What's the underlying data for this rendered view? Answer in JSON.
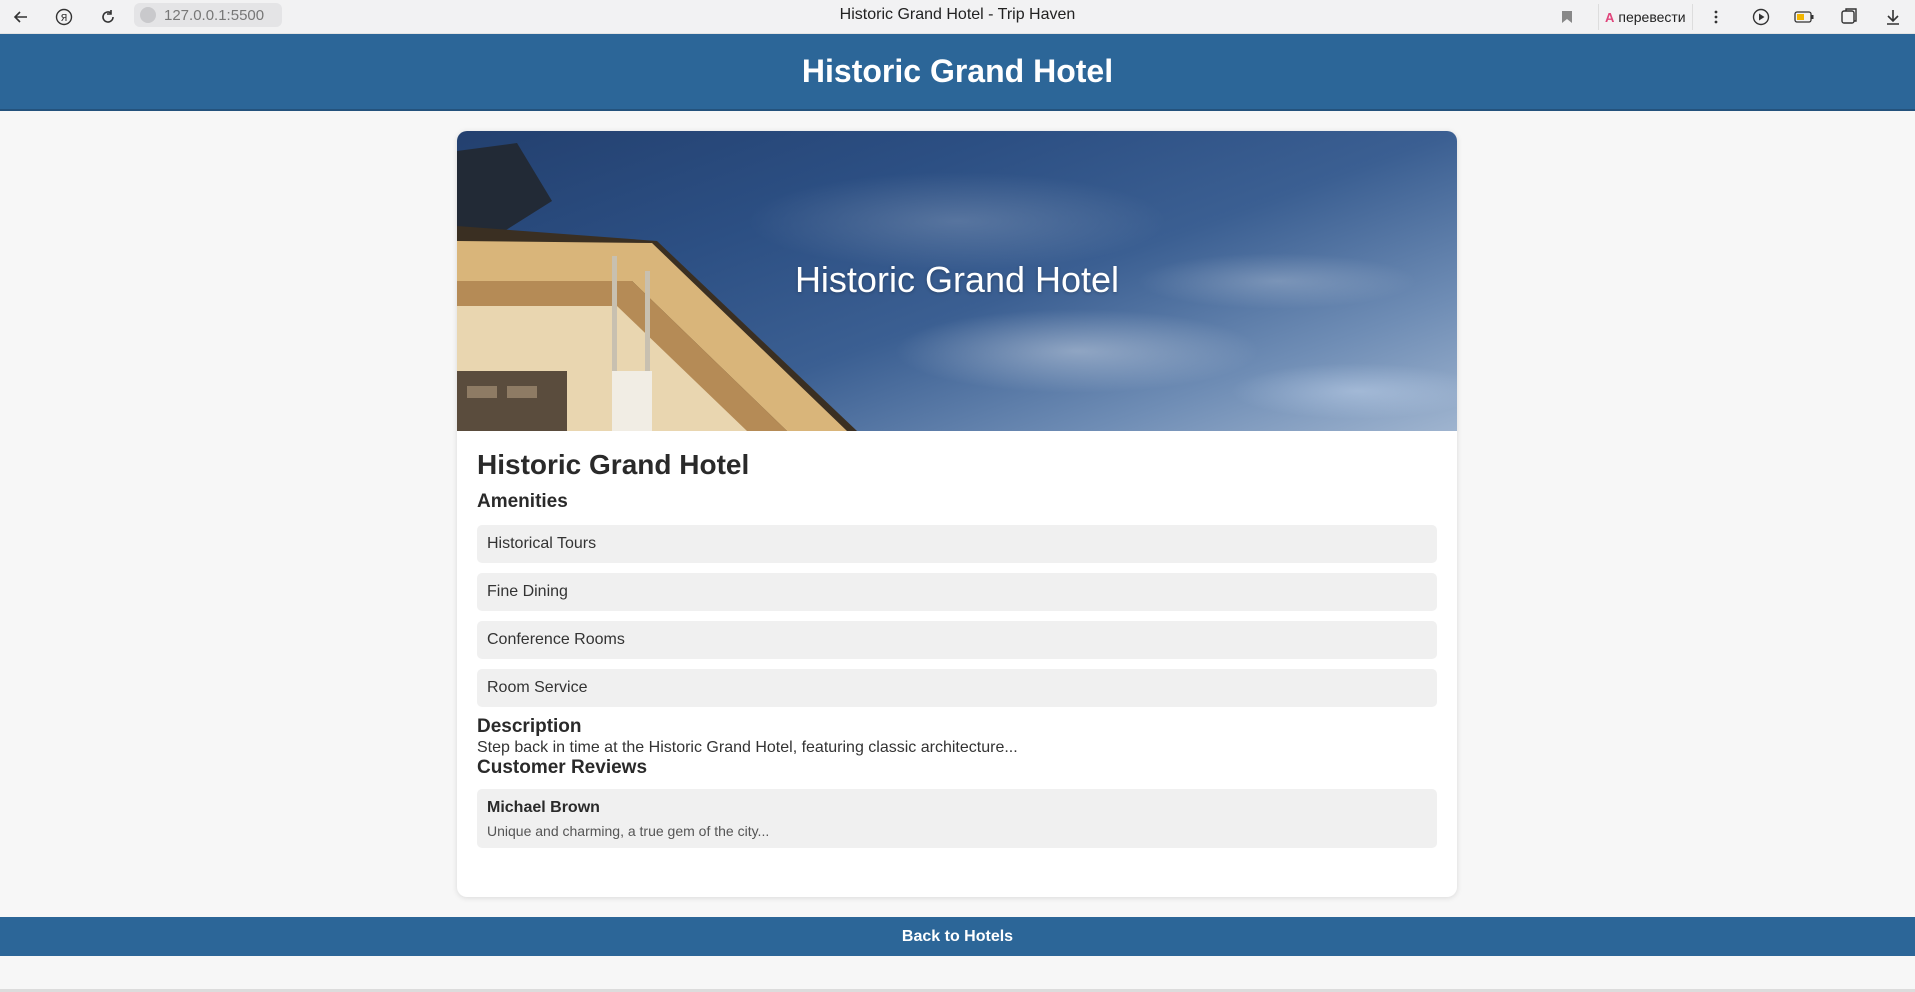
{
  "browser": {
    "url": "127.0.0.1:5500",
    "tab_title": "Historic Grand Hotel - Trip Haven",
    "translate_label": "перевести"
  },
  "header": {
    "title": "Historic Grand Hotel"
  },
  "hotel": {
    "hero_title": "Historic Grand Hotel",
    "name": "Historic Grand Hotel",
    "amenities_heading": "Amenities",
    "amenities": [
      "Historical Tours",
      "Fine Dining",
      "Conference Rooms",
      "Room Service"
    ],
    "description_heading": "Description",
    "description": "Step back in time at the Historic Grand Hotel, featuring classic architecture...",
    "reviews_heading": "Customer Reviews",
    "reviews": [
      {
        "author": "Michael Brown",
        "text": "Unique and charming, a true gem of the city..."
      }
    ]
  },
  "footer": {
    "back_label": "Back to Hotels"
  },
  "colors": {
    "primary": "#2c6698",
    "item_bg": "#f0f0f0",
    "page_bg": "#f7f7f7"
  }
}
